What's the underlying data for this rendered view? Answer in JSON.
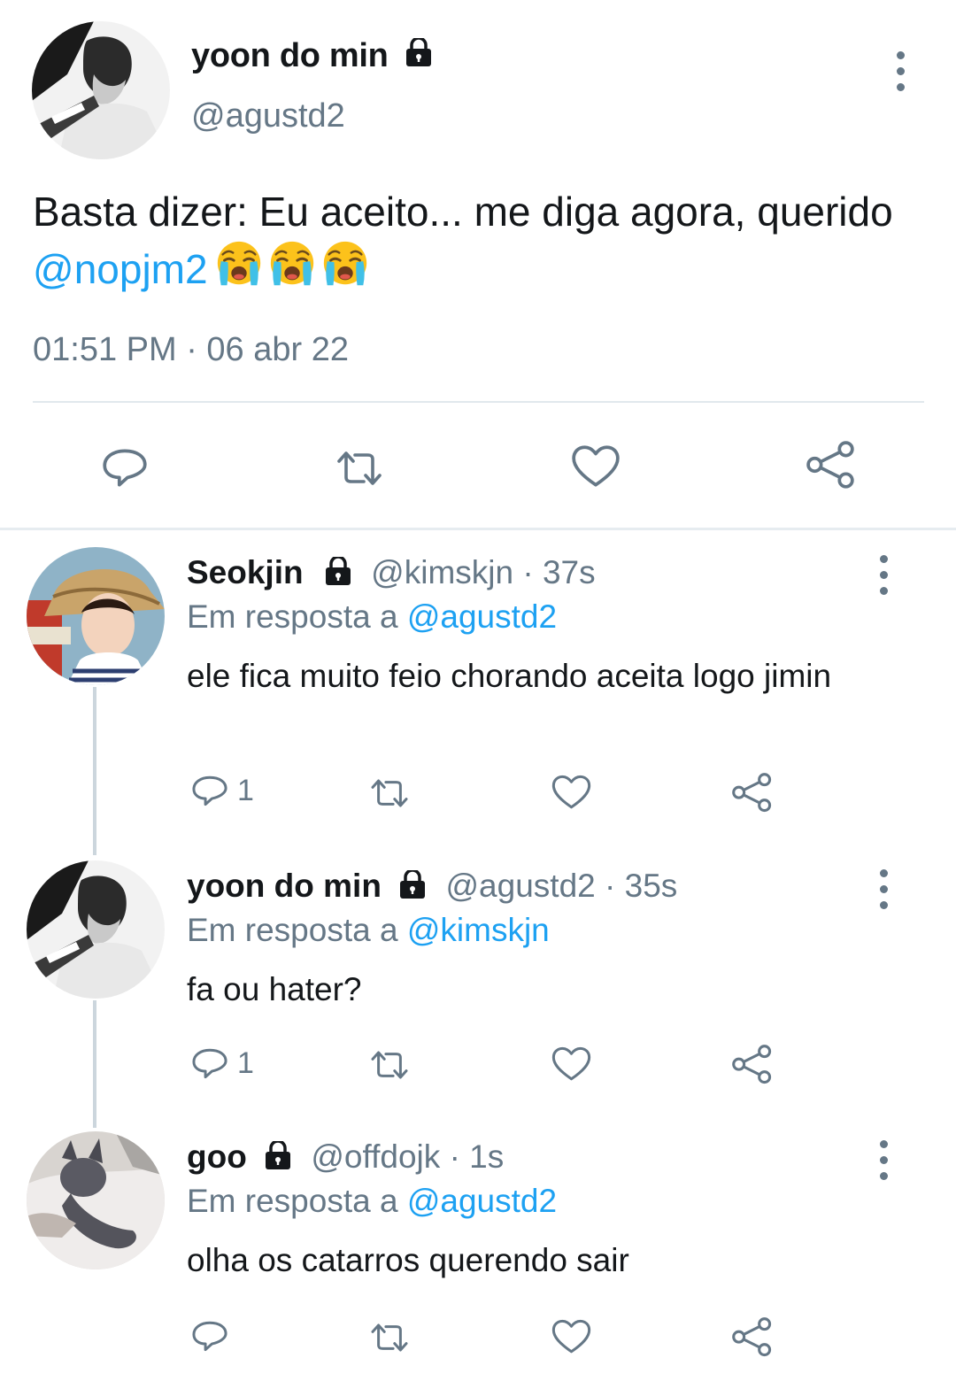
{
  "main_tweet": {
    "display_name": "yoon do min",
    "handle": "@agustd2",
    "text_before": "Basta dizer: Eu aceito... me diga agora, querido ",
    "mention": "@nopjm2",
    "emojis": [
      "loudly-crying-face",
      "loudly-crying-face",
      "loudly-crying-face"
    ],
    "timestamp": "01:51 PM · 06 abr 22",
    "actions": [
      "reply-icon",
      "retweet-icon",
      "like-icon",
      "share-icon"
    ]
  },
  "replies": [
    {
      "display_name": "Seokjin",
      "handle": "@kimskjn",
      "age": "· 37s",
      "reply_prefix": "Em resposta a ",
      "reply_to": "@agustd2",
      "text": "ele fica muito feio chorando aceita logo jimin",
      "reply_count": "1"
    },
    {
      "display_name": "yoon do min",
      "handle": "@agustd2",
      "age": "· 35s",
      "reply_prefix": "Em resposta a ",
      "reply_to": "@kimskjn",
      "text": "fa ou hater?",
      "reply_count": "1"
    },
    {
      "display_name": "goo",
      "handle": "@offdojk",
      "age": "· 1s",
      "reply_prefix": "Em resposta a ",
      "reply_to": "@agustd2",
      "text": "olha os catarros querendo sair",
      "reply_count": ""
    }
  ],
  "colors": {
    "link": "#1da1f2",
    "secondary_text": "#657786",
    "divider": "#e1e8ed"
  }
}
